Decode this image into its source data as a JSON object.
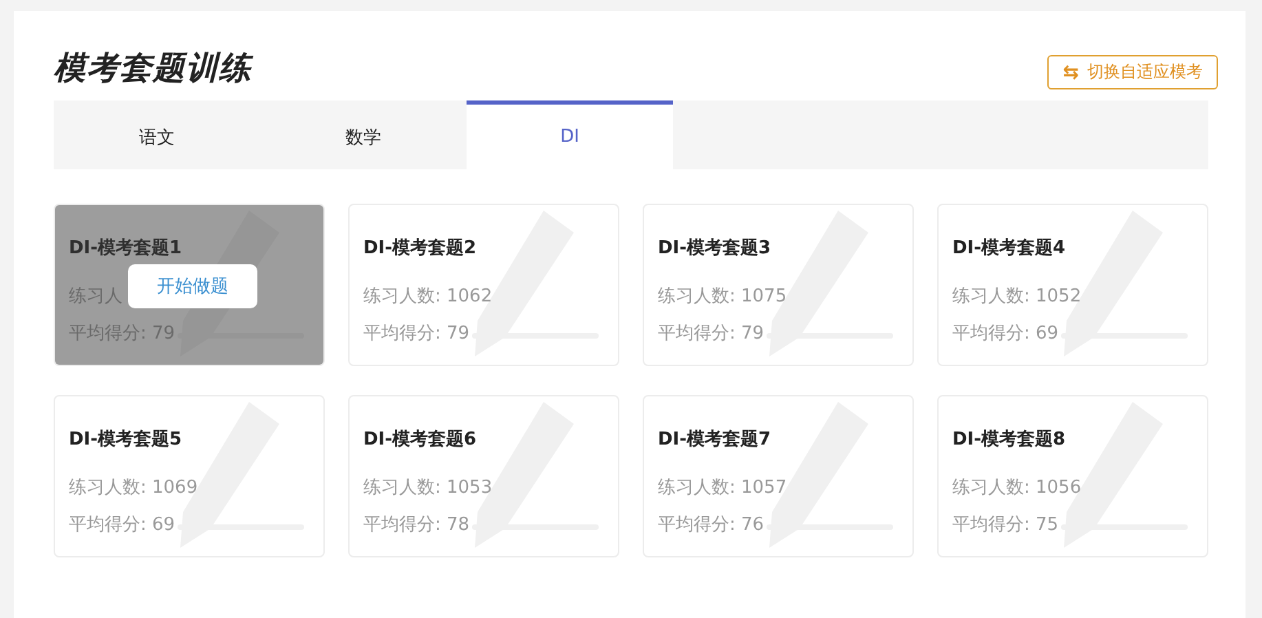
{
  "title": "模考套题训练",
  "switch_button": {
    "icon": "⇆",
    "label": "切换自适应模考"
  },
  "tabs": [
    {
      "label": "语文",
      "selected": false
    },
    {
      "label": "数学",
      "selected": false
    },
    {
      "label": "DI",
      "selected": true
    }
  ],
  "cards": [
    {
      "title": "DI-模考套题1",
      "practice": "练习人",
      "average": "平均得分: 79",
      "hovered": true,
      "action": "开始做题"
    },
    {
      "title": "DI-模考套题2",
      "practice": "练习人数: 1062",
      "average": "平均得分: 79",
      "hovered": false
    },
    {
      "title": "DI-模考套题3",
      "practice": "练习人数: 1075",
      "average": "平均得分: 79",
      "hovered": false
    },
    {
      "title": "DI-模考套题4",
      "practice": "练习人数: 1052",
      "average": "平均得分: 69",
      "hovered": false
    },
    {
      "title": "DI-模考套题5",
      "practice": "练习人数: 1069",
      "average": "平均得分: 69",
      "hovered": false
    },
    {
      "title": "DI-模考套题6",
      "practice": "练习人数: 1053",
      "average": "平均得分: 78",
      "hovered": false
    },
    {
      "title": "DI-模考套题7",
      "practice": "练习人数: 1057",
      "average": "平均得分: 76",
      "hovered": false
    },
    {
      "title": "DI-模考套题8",
      "practice": "练习人数: 1056",
      "average": "平均得分: 75",
      "hovered": false
    }
  ]
}
